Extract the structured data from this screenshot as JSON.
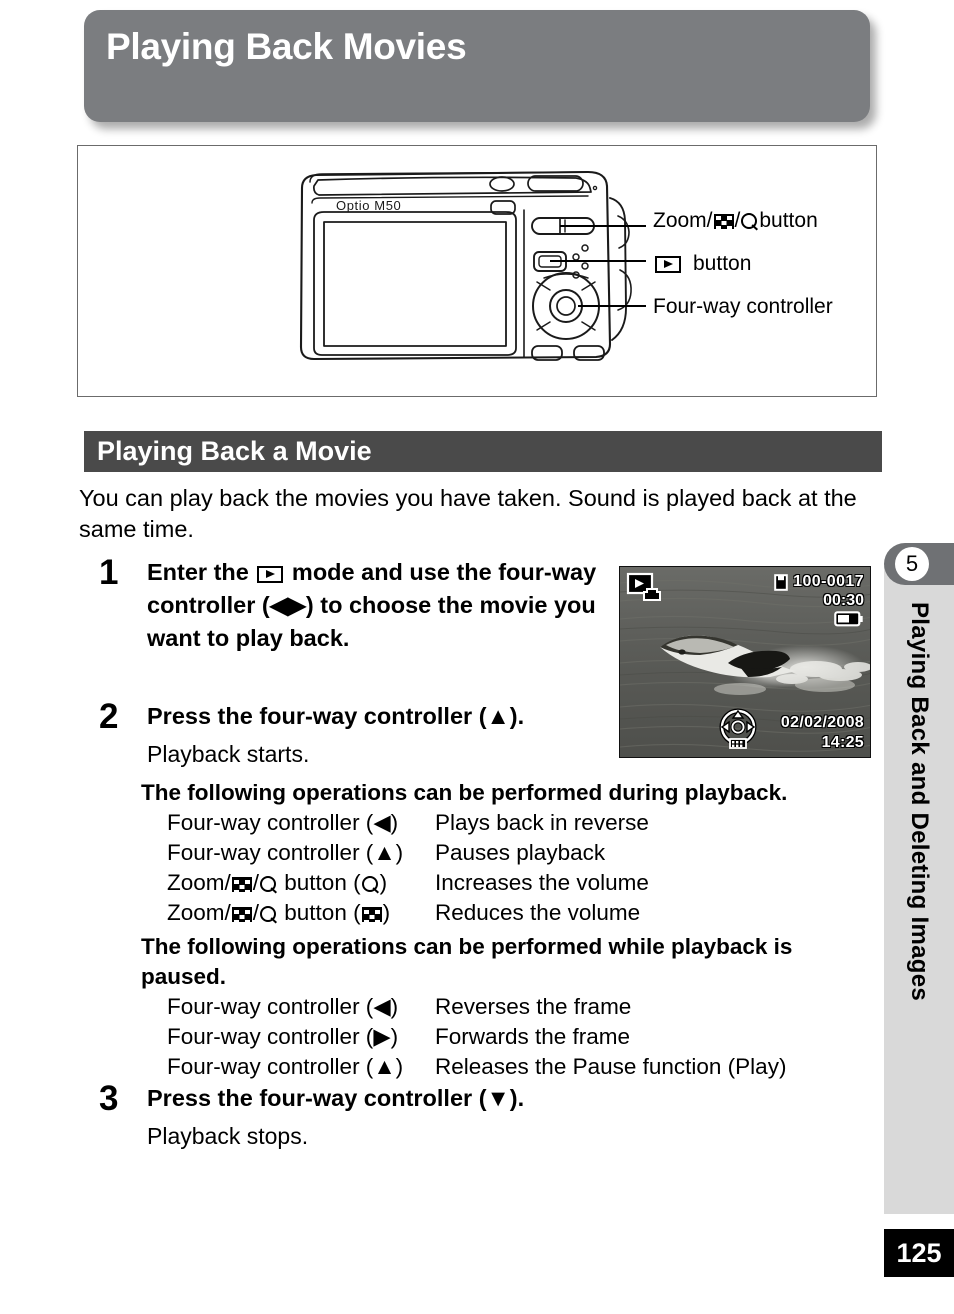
{
  "page": {
    "title": "Playing Back Movies",
    "number": "125"
  },
  "figure": {
    "camera_model": "Optio M50",
    "callouts": [
      {
        "prefix": "Zoom/",
        "icon1": "grid-icon",
        "sep": "/",
        "icon2": "magnifier-icon",
        "suffix": " button",
        "name": "zoom-button-callout"
      },
      {
        "prefix": "",
        "icon1": "play-icon",
        "sep": "",
        "icon2": "",
        "suffix": "  button",
        "name": "playback-button-callout"
      },
      {
        "prefix": "Four-way controller",
        "icon1": "",
        "sep": "",
        "icon2": "",
        "suffix": "",
        "name": "four-way-controller-callout"
      }
    ],
    "callout_1_text": "Zoom/",
    "callout_1_suffix": " button",
    "callout_2_suffix": "button",
    "callout_3_text": "Four-way controller"
  },
  "section": {
    "header": "Playing Back a Movie",
    "intro": "You can play back the movies you have taken. Sound is played back at the same time."
  },
  "steps": [
    {
      "number": "1",
      "title_part1": "Enter the ",
      "title_icon": "play-mode-icon",
      "title_part2": " mode and use the four-way controller (",
      "title_icon2": "left-arrow",
      "title_icon3": "right-arrow",
      "title_part3": ") to choose the movie you want to play back.",
      "sub": ""
    },
    {
      "number": "2",
      "title_part1": "Press the four-way controller (",
      "title_icon": "up-arrow",
      "title_part3": ").",
      "sub": "Playback starts."
    },
    {
      "number": "3",
      "title_part1": "Press the four-way controller (",
      "title_icon": "down-arrow",
      "title_part3": ").",
      "sub": "Playback stops."
    }
  ],
  "operations_during_playback": {
    "heading": "The following operations can be performed during playback.",
    "rows": [
      {
        "key_text": "Four-way controller (",
        "key_icon": "left-arrow",
        "key_end": ")",
        "value": "Plays back in reverse"
      },
      {
        "key_text": "Four-way controller (",
        "key_icon": "up-arrow",
        "key_end": ")",
        "value": "Pauses playback"
      },
      {
        "key_text": "Zoom/",
        "key_icon": "magnifier-icon",
        "key_end": ")",
        "value": "Increases the volume"
      },
      {
        "key_text": "Zoom/",
        "key_icon": "grid-icon",
        "key_end": ")",
        "value": "Reduces the volume"
      }
    ]
  },
  "operations_while_paused": {
    "heading": "The following operations can be performed while playback is paused.",
    "rows": [
      {
        "key_text": "Four-way controller (",
        "key_icon": "left-arrow",
        "key_end": ")",
        "value": "Reverses the frame"
      },
      {
        "key_text": "Four-way controller (",
        "key_icon": "right-arrow",
        "key_end": ")",
        "value": "Forwards the frame"
      },
      {
        "key_text": "Four-way controller (",
        "key_icon": "up-arrow",
        "key_end": ")",
        "value": "Releases the Pause function (Play)"
      }
    ]
  },
  "lcd_preview": {
    "file_number": "100-0017",
    "duration": "00:30",
    "date": "02/02/2008",
    "time": "14:25",
    "mode_icon": "movie-playback-icon",
    "battery_icon": "battery-icon",
    "folder_icon": "folder-icon",
    "guide_icon": "four-way-guide-icon"
  },
  "sidebar": {
    "chapter_number": "5",
    "chapter_title": "Playing Back and Deleting Images"
  },
  "colors": {
    "title_banner": "#7b7d80",
    "section_header": "#4a4a4a",
    "sidebar_bg": "#d9d9d9",
    "chapter_tab": "#6f7174"
  }
}
